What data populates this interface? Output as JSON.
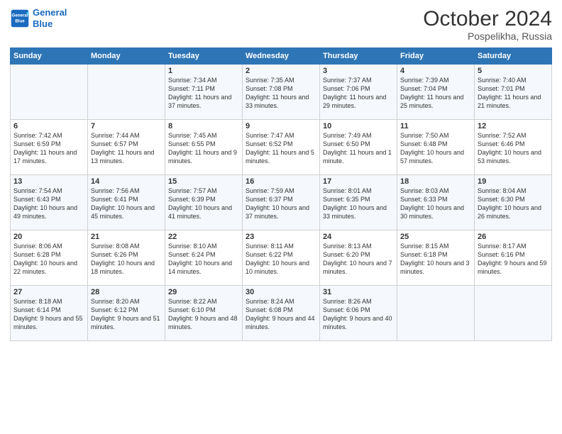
{
  "logo": {
    "line1": "General",
    "line2": "Blue"
  },
  "header": {
    "month": "October 2024",
    "location": "Pospelikha, Russia"
  },
  "days_of_week": [
    "Sunday",
    "Monday",
    "Tuesday",
    "Wednesday",
    "Thursday",
    "Friday",
    "Saturday"
  ],
  "rows": [
    [
      {
        "day": "",
        "sunrise": "",
        "sunset": "",
        "daylight": ""
      },
      {
        "day": "",
        "sunrise": "",
        "sunset": "",
        "daylight": ""
      },
      {
        "day": "1",
        "sunrise": "Sunrise: 7:34 AM",
        "sunset": "Sunset: 7:11 PM",
        "daylight": "Daylight: 11 hours and 37 minutes."
      },
      {
        "day": "2",
        "sunrise": "Sunrise: 7:35 AM",
        "sunset": "Sunset: 7:08 PM",
        "daylight": "Daylight: 11 hours and 33 minutes."
      },
      {
        "day": "3",
        "sunrise": "Sunrise: 7:37 AM",
        "sunset": "Sunset: 7:06 PM",
        "daylight": "Daylight: 11 hours and 29 minutes."
      },
      {
        "day": "4",
        "sunrise": "Sunrise: 7:39 AM",
        "sunset": "Sunset: 7:04 PM",
        "daylight": "Daylight: 11 hours and 25 minutes."
      },
      {
        "day": "5",
        "sunrise": "Sunrise: 7:40 AM",
        "sunset": "Sunset: 7:01 PM",
        "daylight": "Daylight: 11 hours and 21 minutes."
      }
    ],
    [
      {
        "day": "6",
        "sunrise": "Sunrise: 7:42 AM",
        "sunset": "Sunset: 6:59 PM",
        "daylight": "Daylight: 11 hours and 17 minutes."
      },
      {
        "day": "7",
        "sunrise": "Sunrise: 7:44 AM",
        "sunset": "Sunset: 6:57 PM",
        "daylight": "Daylight: 11 hours and 13 minutes."
      },
      {
        "day": "8",
        "sunrise": "Sunrise: 7:45 AM",
        "sunset": "Sunset: 6:55 PM",
        "daylight": "Daylight: 11 hours and 9 minutes."
      },
      {
        "day": "9",
        "sunrise": "Sunrise: 7:47 AM",
        "sunset": "Sunset: 6:52 PM",
        "daylight": "Daylight: 11 hours and 5 minutes."
      },
      {
        "day": "10",
        "sunrise": "Sunrise: 7:49 AM",
        "sunset": "Sunset: 6:50 PM",
        "daylight": "Daylight: 11 hours and 1 minute."
      },
      {
        "day": "11",
        "sunrise": "Sunrise: 7:50 AM",
        "sunset": "Sunset: 6:48 PM",
        "daylight": "Daylight: 10 hours and 57 minutes."
      },
      {
        "day": "12",
        "sunrise": "Sunrise: 7:52 AM",
        "sunset": "Sunset: 6:46 PM",
        "daylight": "Daylight: 10 hours and 53 minutes."
      }
    ],
    [
      {
        "day": "13",
        "sunrise": "Sunrise: 7:54 AM",
        "sunset": "Sunset: 6:43 PM",
        "daylight": "Daylight: 10 hours and 49 minutes."
      },
      {
        "day": "14",
        "sunrise": "Sunrise: 7:56 AM",
        "sunset": "Sunset: 6:41 PM",
        "daylight": "Daylight: 10 hours and 45 minutes."
      },
      {
        "day": "15",
        "sunrise": "Sunrise: 7:57 AM",
        "sunset": "Sunset: 6:39 PM",
        "daylight": "Daylight: 10 hours and 41 minutes."
      },
      {
        "day": "16",
        "sunrise": "Sunrise: 7:59 AM",
        "sunset": "Sunset: 6:37 PM",
        "daylight": "Daylight: 10 hours and 37 minutes."
      },
      {
        "day": "17",
        "sunrise": "Sunrise: 8:01 AM",
        "sunset": "Sunset: 6:35 PM",
        "daylight": "Daylight: 10 hours and 33 minutes."
      },
      {
        "day": "18",
        "sunrise": "Sunrise: 8:03 AM",
        "sunset": "Sunset: 6:33 PM",
        "daylight": "Daylight: 10 hours and 30 minutes."
      },
      {
        "day": "19",
        "sunrise": "Sunrise: 8:04 AM",
        "sunset": "Sunset: 6:30 PM",
        "daylight": "Daylight: 10 hours and 26 minutes."
      }
    ],
    [
      {
        "day": "20",
        "sunrise": "Sunrise: 8:06 AM",
        "sunset": "Sunset: 6:28 PM",
        "daylight": "Daylight: 10 hours and 22 minutes."
      },
      {
        "day": "21",
        "sunrise": "Sunrise: 8:08 AM",
        "sunset": "Sunset: 6:26 PM",
        "daylight": "Daylight: 10 hours and 18 minutes."
      },
      {
        "day": "22",
        "sunrise": "Sunrise: 8:10 AM",
        "sunset": "Sunset: 6:24 PM",
        "daylight": "Daylight: 10 hours and 14 minutes."
      },
      {
        "day": "23",
        "sunrise": "Sunrise: 8:11 AM",
        "sunset": "Sunset: 6:22 PM",
        "daylight": "Daylight: 10 hours and 10 minutes."
      },
      {
        "day": "24",
        "sunrise": "Sunrise: 8:13 AM",
        "sunset": "Sunset: 6:20 PM",
        "daylight": "Daylight: 10 hours and 7 minutes."
      },
      {
        "day": "25",
        "sunrise": "Sunrise: 8:15 AM",
        "sunset": "Sunset: 6:18 PM",
        "daylight": "Daylight: 10 hours and 3 minutes."
      },
      {
        "day": "26",
        "sunrise": "Sunrise: 8:17 AM",
        "sunset": "Sunset: 6:16 PM",
        "daylight": "Daylight: 9 hours and 59 minutes."
      }
    ],
    [
      {
        "day": "27",
        "sunrise": "Sunrise: 8:18 AM",
        "sunset": "Sunset: 6:14 PM",
        "daylight": "Daylight: 9 hours and 55 minutes."
      },
      {
        "day": "28",
        "sunrise": "Sunrise: 8:20 AM",
        "sunset": "Sunset: 6:12 PM",
        "daylight": "Daylight: 9 hours and 51 minutes."
      },
      {
        "day": "29",
        "sunrise": "Sunrise: 8:22 AM",
        "sunset": "Sunset: 6:10 PM",
        "daylight": "Daylight: 9 hours and 48 minutes."
      },
      {
        "day": "30",
        "sunrise": "Sunrise: 8:24 AM",
        "sunset": "Sunset: 6:08 PM",
        "daylight": "Daylight: 9 hours and 44 minutes."
      },
      {
        "day": "31",
        "sunrise": "Sunrise: 8:26 AM",
        "sunset": "Sunset: 6:06 PM",
        "daylight": "Daylight: 9 hours and 40 minutes."
      },
      {
        "day": "",
        "sunrise": "",
        "sunset": "",
        "daylight": ""
      },
      {
        "day": "",
        "sunrise": "",
        "sunset": "",
        "daylight": ""
      }
    ]
  ]
}
